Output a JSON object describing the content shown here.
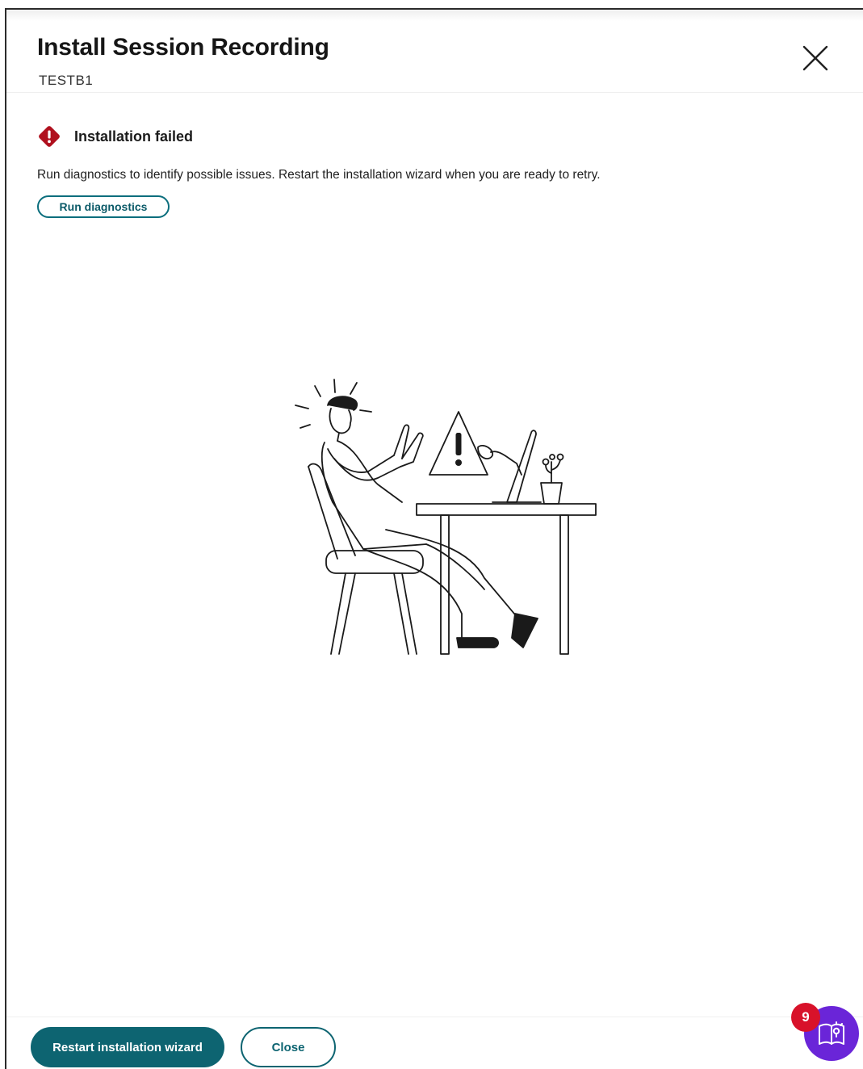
{
  "header": {
    "title": "Install Session Recording",
    "subtitle": "TESTB1",
    "close_icon": "close-icon"
  },
  "status": {
    "icon": "error-diamond-icon",
    "text": "Installation failed",
    "color": "#b0101e"
  },
  "message": "Run diagnostics to identify possible issues. Restart the installation wizard when you are ready to retry.",
  "actions": {
    "run_diagnostics": "Run diagnostics"
  },
  "footer": {
    "restart_label": "Restart installation wizard",
    "close_label": "Close"
  },
  "help_widget": {
    "badge_count": "9",
    "icon": "guide-book-icon",
    "color": "#6a25d8"
  },
  "colors": {
    "primary": "#0d6471",
    "error": "#b0101e",
    "badge": "#d8122a"
  }
}
